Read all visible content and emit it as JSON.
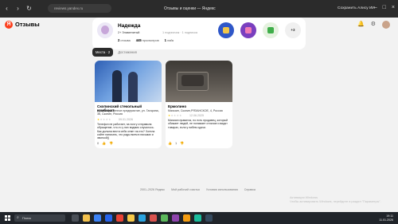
{
  "browser": {
    "address": "reviews.yandex.ru",
    "tab_title": "Отзывы и оценки — Яндекс",
    "save_button": "Сохранить Алису ИИ"
  },
  "site": {
    "title": "Отзывы"
  },
  "profile": {
    "name": "Надежда",
    "level": "2+ Знаменитый",
    "subs": "1 подписчик · 1 подписка",
    "stats": [
      {
        "value": "2",
        "label": "отзыва"
      },
      {
        "value": "445",
        "label": "просмотров"
      },
      {
        "value": "1",
        "label": "лайк"
      }
    ],
    "more_badges": "+3"
  },
  "tabs": [
    {
      "label": "Места · 2",
      "active": true
    },
    {
      "label": "Достижения",
      "active": false
    }
  ],
  "reviews": [
    {
      "title": "Скопинский стекольный комбинат",
      "address": "Производственное предприятие, ул. Гагарина, 36, Скопин, Россия",
      "rating": 1,
      "date": "09.01.2026",
      "text": "Телефон не работает, на почту отправила обращение, что-то у них видимо случилось. Как должна вести себя ответ на это? Хотела сайте написать, что рады всем в письмах и звонкой))",
      "likes": "0"
    },
    {
      "title": "Ермолино",
      "address": "Магазин, Скопин,РЯЗАНСКОЕ, 4, Россия",
      "rating": 1,
      "date": "12.06.2025",
      "text": "Магазин нравится, но есть продавец, который обижает людей, не понимает отличие и видят товарах, если у нибем сдачи.",
      "likes": "1"
    }
  ],
  "footer": [
    "2001–2026 Яндекс",
    "Мой рабочий счастья",
    "Условия использования",
    "Справка"
  ],
  "activation": {
    "line1": "Активация Windows",
    "line2": "Чтобы активировать Windows, перейдите в раздел \"Параметры\"."
  },
  "taskbar": {
    "search_placeholder": "Поиск",
    "time": "19:11",
    "date": "11.01.2026"
  }
}
